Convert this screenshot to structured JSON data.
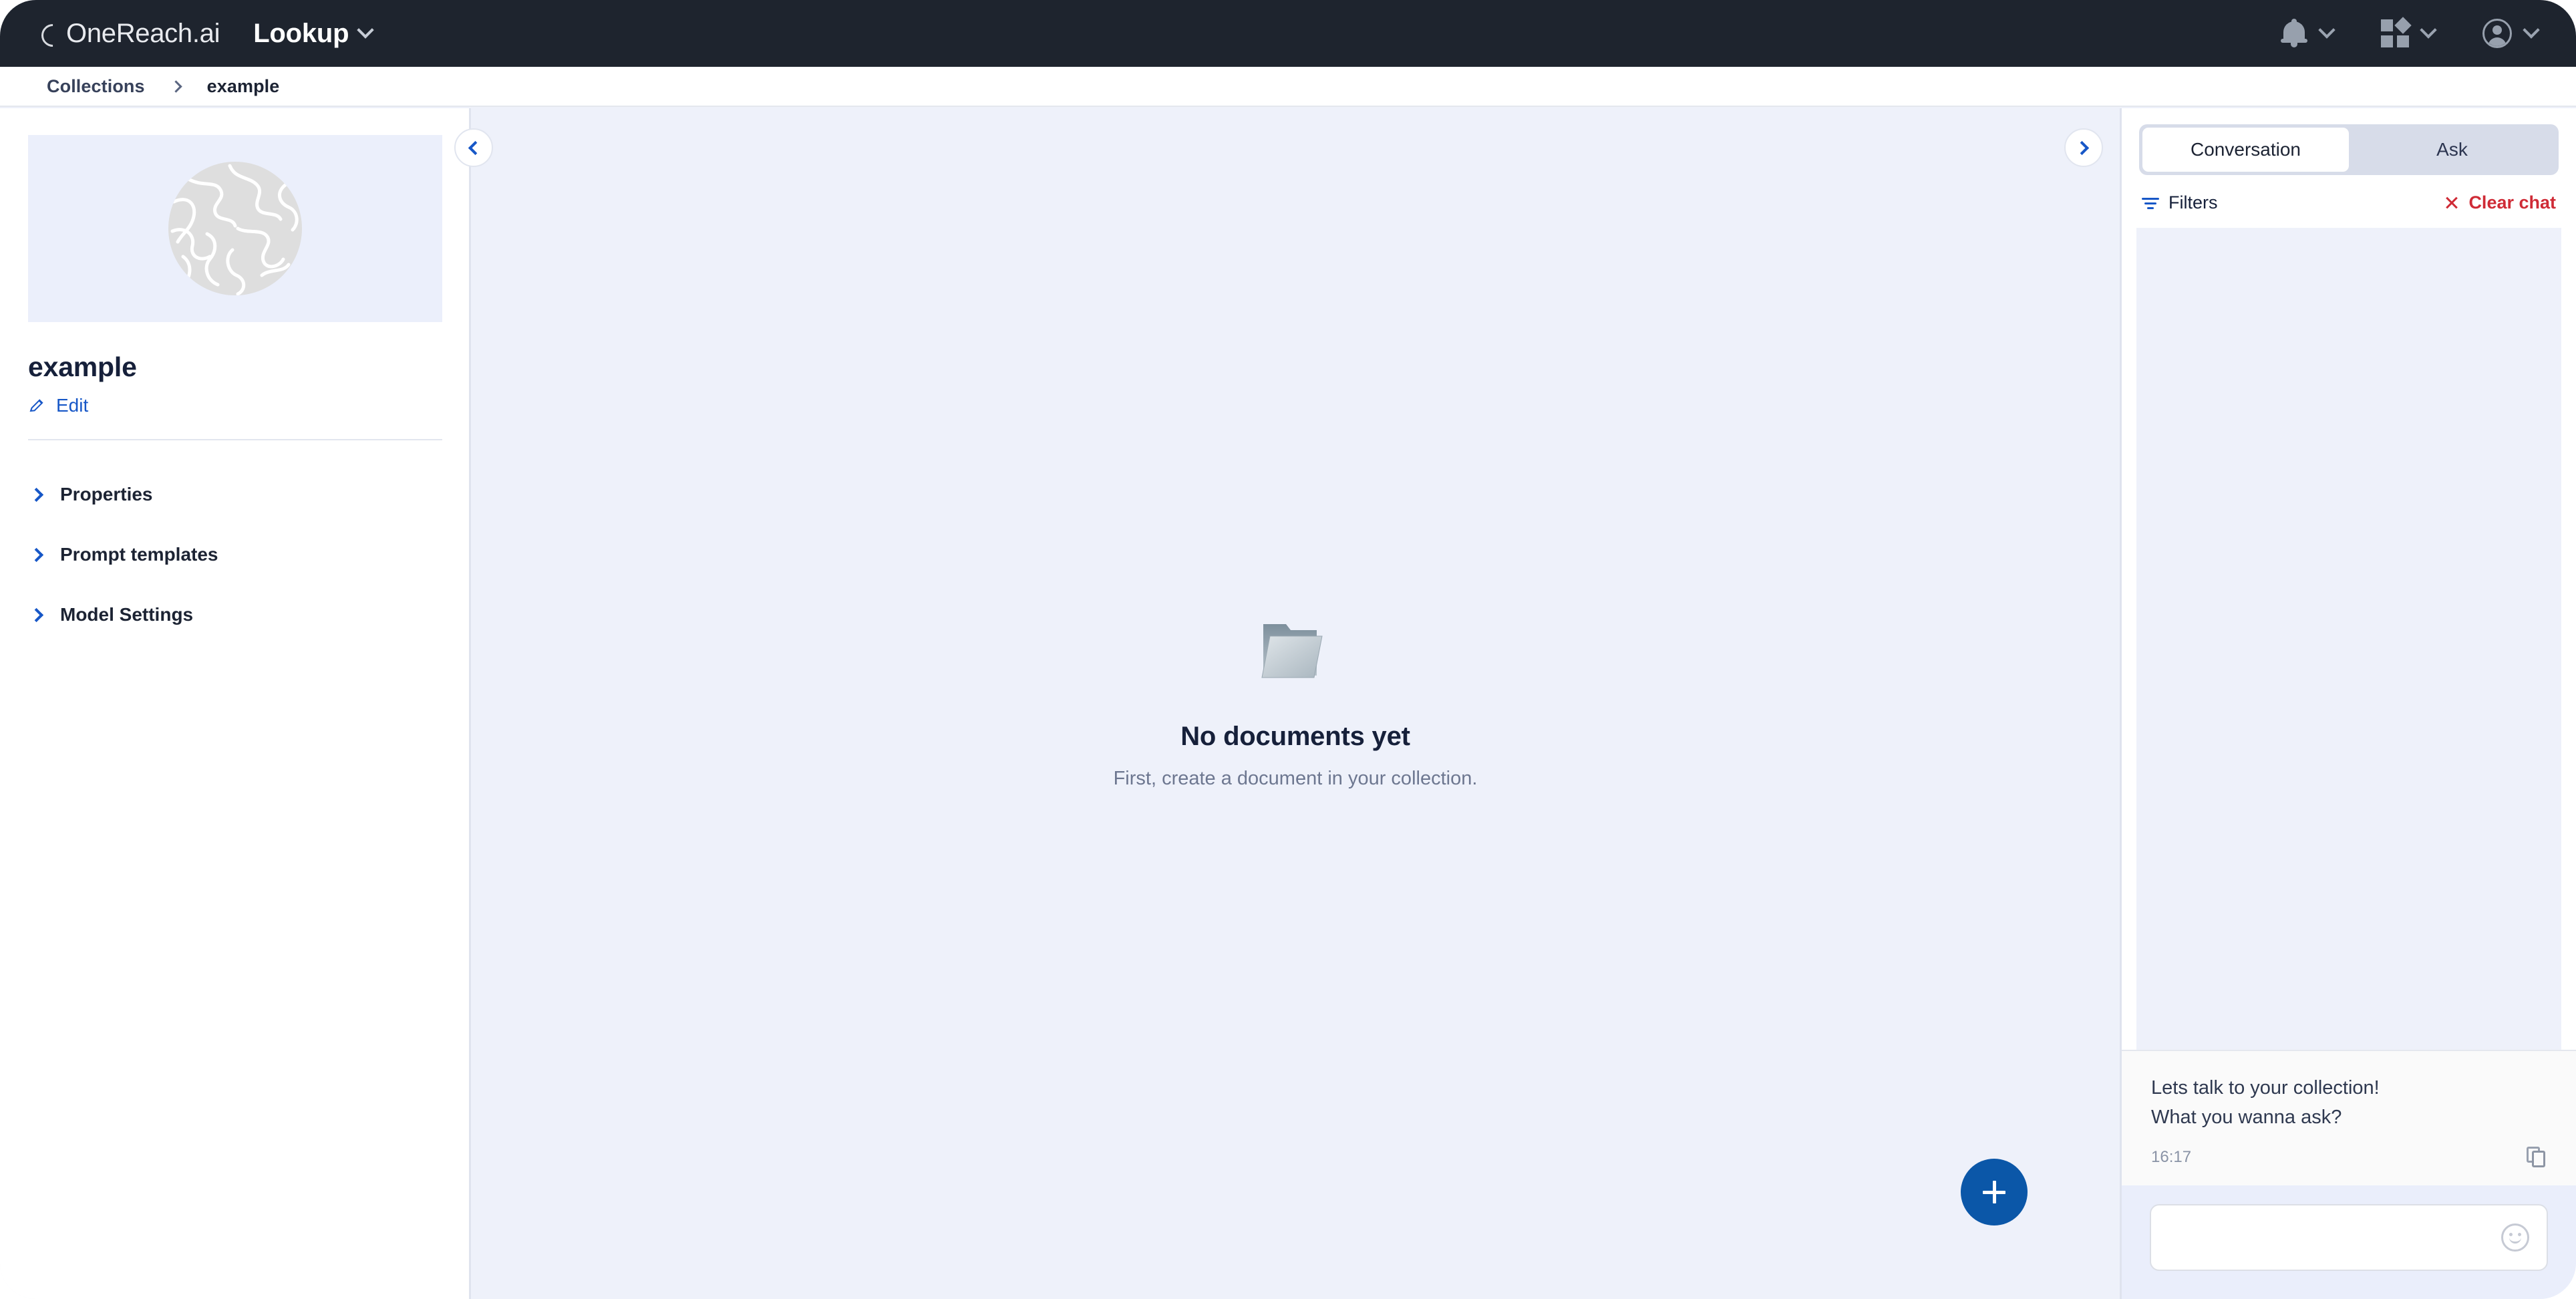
{
  "topbar": {
    "brand": "OneReach.ai",
    "app_name": "Lookup",
    "icons": {
      "notifications": "bell-icon",
      "apps": "apps-grid-icon",
      "account": "user-account-icon",
      "chevron": "chevron-down-icon"
    }
  },
  "breadcrumb": {
    "root": "Collections",
    "current": "example"
  },
  "sidebar": {
    "collection_name": "example",
    "edit_label": "Edit",
    "sections": [
      {
        "label": "Properties"
      },
      {
        "label": "Prompt templates"
      },
      {
        "label": "Model Settings"
      }
    ]
  },
  "main": {
    "empty_title": "No documents yet",
    "empty_subtitle": "First, create a document in your collection.",
    "fab_label": "+"
  },
  "chat": {
    "tabs": [
      {
        "label": "Conversation",
        "active": true
      },
      {
        "label": "Ask",
        "active": false
      }
    ],
    "filters_label": "Filters",
    "clear_label": "Clear chat",
    "message": {
      "line1": "Lets talk to your collection!",
      "line2": "What you wanna ask?",
      "time": "16:17"
    },
    "composer_placeholder": "",
    "composer_value": ""
  },
  "colors": {
    "header_bg": "#1e242e",
    "accent_blue": "#1757c7",
    "fab_blue": "#0b57a8",
    "danger_red": "#cf2b36",
    "canvas_bg": "#eef1fa"
  }
}
